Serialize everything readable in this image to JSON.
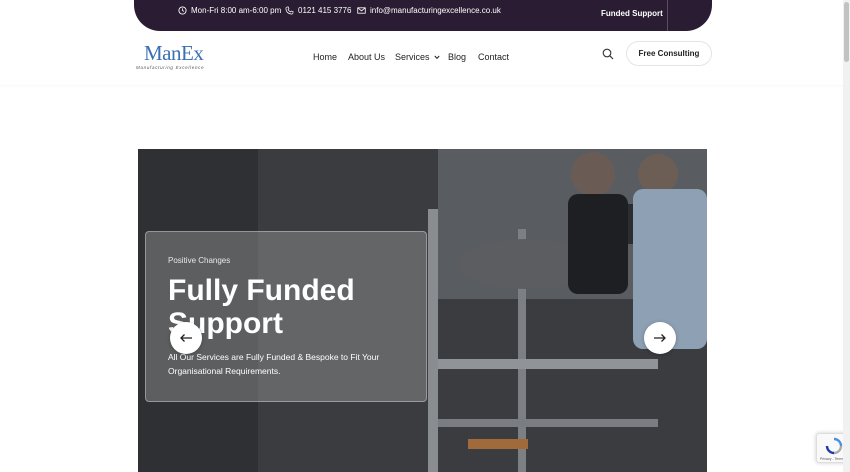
{
  "topbar": {
    "hours": "Mon-Fri 8:00 am-6:00 pm",
    "phone": "0121 415 3776",
    "email": "info@manufacturingexcellence.co.uk",
    "funded_support": "Funded Support"
  },
  "logo": {
    "brand": "ManEx",
    "tagline": "Manufacturing Excellence"
  },
  "nav": {
    "items": [
      "Home",
      "About Us",
      "Services",
      "Blog",
      "Contact"
    ]
  },
  "header": {
    "cta": "Free Consulting"
  },
  "hero": {
    "eyebrow": "Positive Changes",
    "title": "Fully Funded Support",
    "description": "All Our Services are Fully Funded & Bespoke to Fit Your Organisational Requirements."
  },
  "recaptcha": {
    "links": "Privacy - Terms"
  },
  "colors": {
    "topbar_bg": "#2a1d33",
    "brand_blue": "#3c6fb4"
  }
}
